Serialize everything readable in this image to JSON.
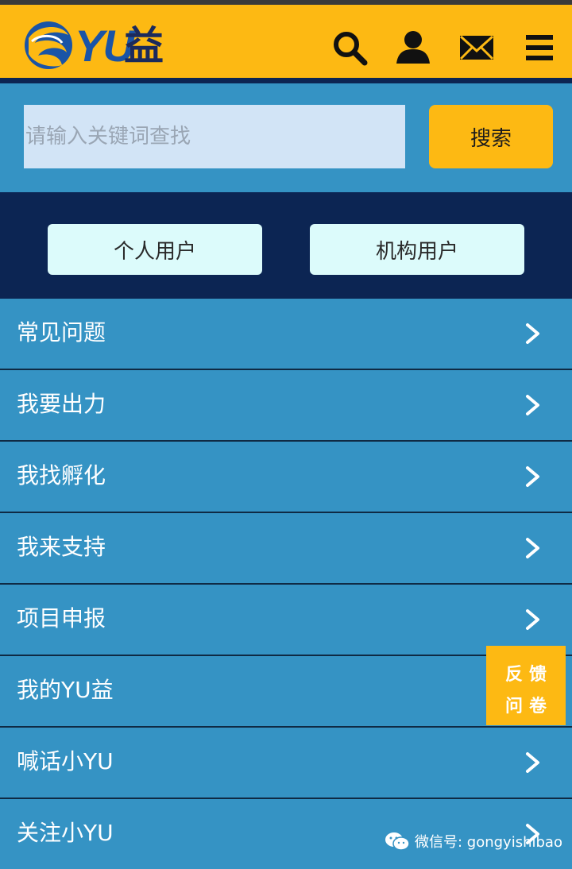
{
  "header": {
    "logo_text": "YU",
    "logo_cn": "益",
    "icons": [
      "search-icon",
      "user-icon",
      "mail-icon",
      "menu-icon"
    ]
  },
  "search": {
    "placeholder": "请输入关键词查找",
    "value": "",
    "button_label": "搜索"
  },
  "user_types": {
    "personal": "个人用户",
    "institution": "机构用户"
  },
  "menu": {
    "items": [
      {
        "label": "常见问题"
      },
      {
        "label": "我要出力"
      },
      {
        "label": "我找孵化"
      },
      {
        "label": "我来支持"
      },
      {
        "label": "项目申报"
      },
      {
        "label": "我的YU益"
      },
      {
        "label": "喊话小YU"
      },
      {
        "label": "关注小YU"
      }
    ]
  },
  "feedback": {
    "line1": "反馈",
    "line2": "问卷"
  },
  "watermark": {
    "text": "微信号: gongyishibao"
  },
  "colors": {
    "header": "#fdb913",
    "navy": "#0c2553",
    "menu_bg": "#3593c4",
    "input_bg": "#d2e4f6",
    "user_btn_bg": "#dcfbfb"
  }
}
